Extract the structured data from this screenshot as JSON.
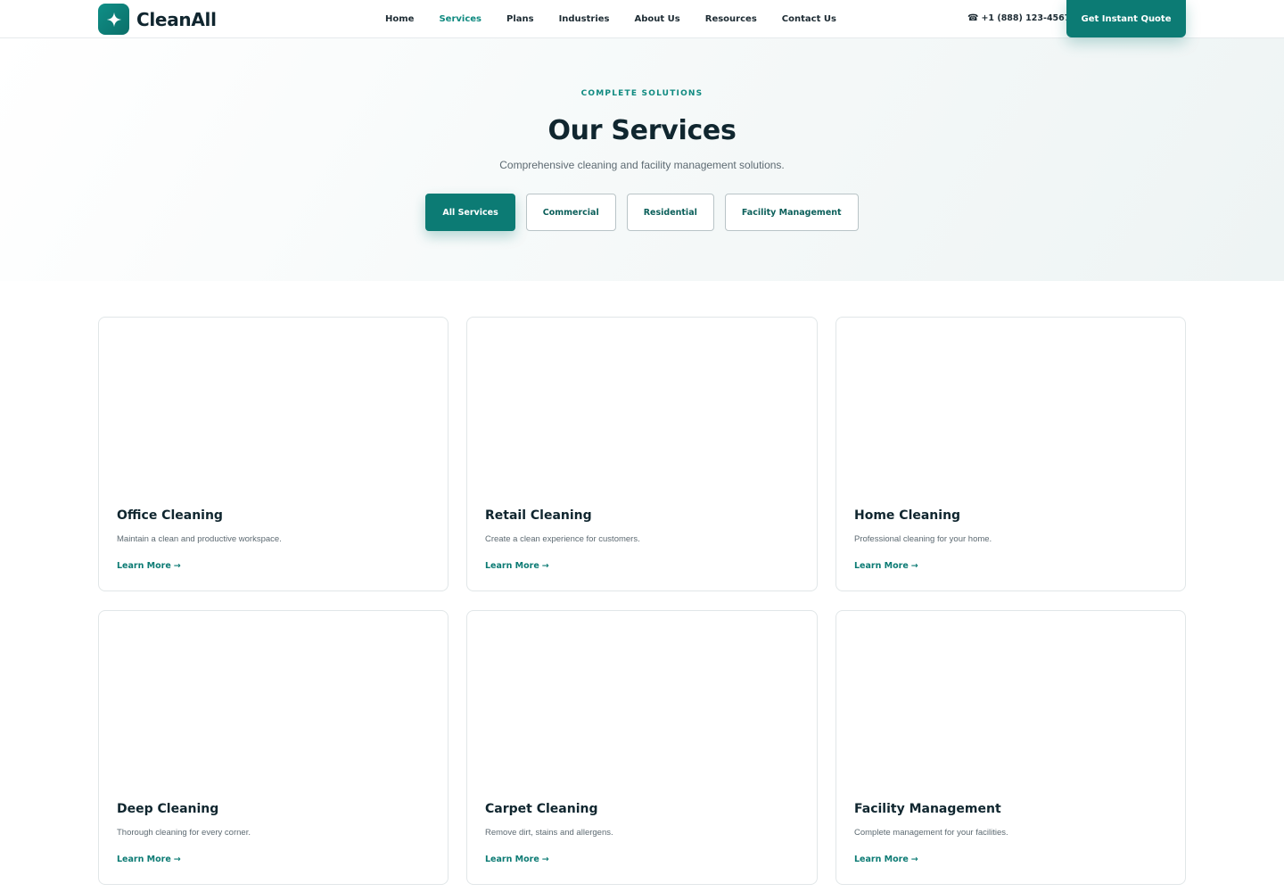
{
  "brand": {
    "name": "CleanAll",
    "logo_icon": "sparkle-icon",
    "accent_color": "#0c7b74"
  },
  "nav": {
    "items": [
      {
        "label": "Home",
        "active": false
      },
      {
        "label": "Services",
        "active": true
      },
      {
        "label": "Plans",
        "active": false
      },
      {
        "label": "Industries",
        "active": false
      },
      {
        "label": "About Us",
        "active": false
      },
      {
        "label": "Resources",
        "active": false
      },
      {
        "label": "Contact Us",
        "active": false
      }
    ]
  },
  "header": {
    "phone": "+1 (888) 123-4567",
    "phone_icon": "phone-icon",
    "cta_label": "Get Instant Quote"
  },
  "hero": {
    "eyebrow": "COMPLETE SOLUTIONS",
    "title": "Our Services",
    "subtitle": "Comprehensive cleaning and facility management solutions.",
    "filters": [
      {
        "label": "All Services",
        "active": true
      },
      {
        "label": "Commercial",
        "active": false
      },
      {
        "label": "Residential",
        "active": false
      },
      {
        "label": "Facility Management",
        "active": false
      }
    ]
  },
  "services": [
    {
      "title": "Office Cleaning",
      "description": "Maintain a clean and productive workspace.",
      "link": "Learn More"
    },
    {
      "title": "Retail Cleaning",
      "description": "Create a clean experience for customers.",
      "link": "Learn More"
    },
    {
      "title": "Home Cleaning",
      "description": "Professional cleaning for your home.",
      "link": "Learn More"
    },
    {
      "title": "Deep Cleaning",
      "description": "Thorough cleaning for every corner.",
      "link": "Learn More"
    },
    {
      "title": "Carpet Cleaning",
      "description": "Remove dirt, stains and allergens.",
      "link": "Learn More"
    },
    {
      "title": "Facility Management",
      "description": "Complete management for your facilities.",
      "link": "Learn More"
    }
  ]
}
